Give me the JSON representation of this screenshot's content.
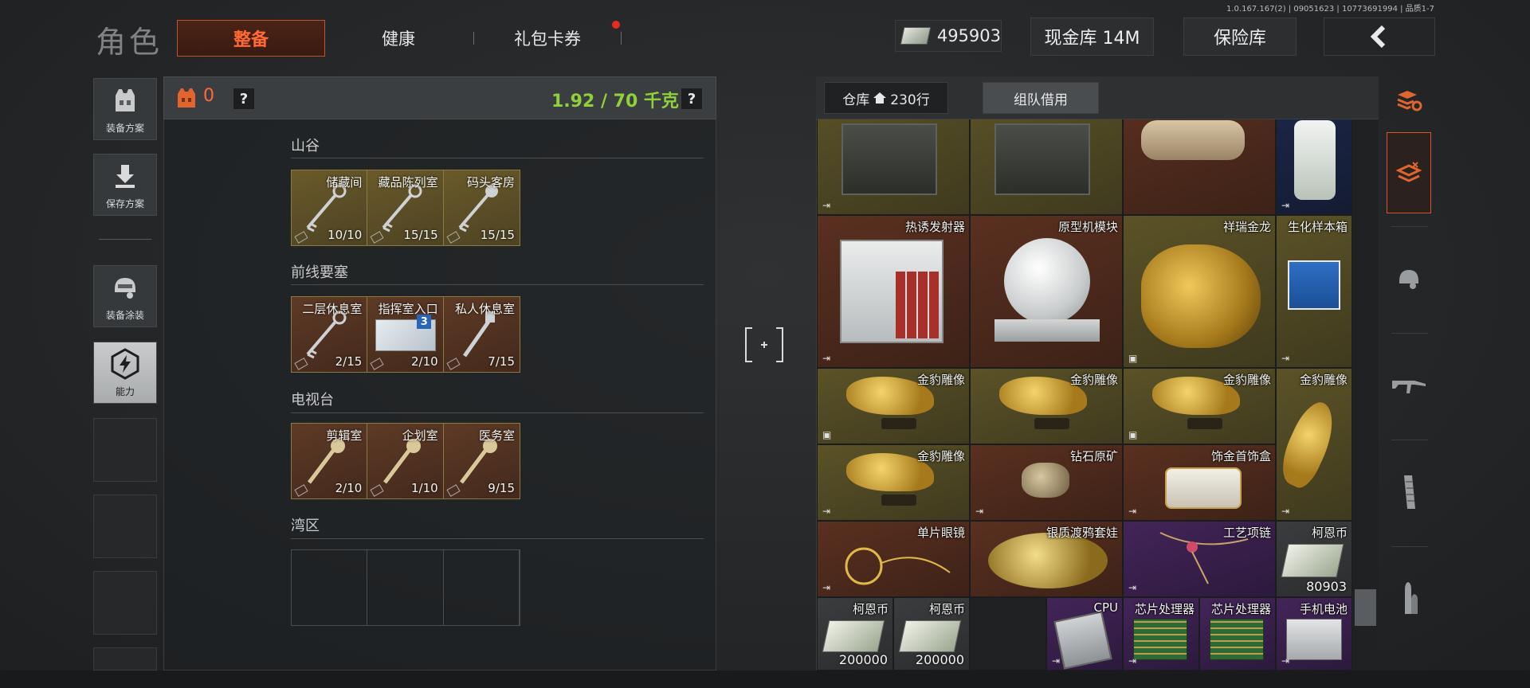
{
  "version": "1.0.167.167(2) | 09051623 | 10773691994 | 品质1-7",
  "header": {
    "title": "角色",
    "tabs": [
      {
        "label": "整备",
        "active": true
      },
      {
        "label": "健康",
        "active": false
      },
      {
        "label": "礼包卡券",
        "active": false,
        "notification": true
      }
    ],
    "currency": "495903",
    "cash_vault": "现金库 14M",
    "safe": "保险库"
  },
  "sidebar": {
    "items": [
      {
        "label": "装备方案",
        "icon": "vest-icon"
      },
      {
        "label": "保存方案",
        "icon": "download-icon"
      },
      {
        "label": "装备涂装",
        "icon": "helmet-icon"
      },
      {
        "label": "能力",
        "icon": "ability-icon",
        "active": true
      }
    ]
  },
  "inventory": {
    "count": "0",
    "help": "?",
    "weight": "1.92 / 70 千克",
    "sections": [
      {
        "title": "山谷",
        "keys": [
          {
            "name": "储藏间",
            "count": "10/10",
            "color": "olive"
          },
          {
            "name": "藏品陈列室",
            "count": "15/15",
            "color": "olive"
          },
          {
            "name": "码头客房",
            "count": "15/15",
            "color": "olive"
          }
        ]
      },
      {
        "title": "前线要塞",
        "keys": [
          {
            "name": "二层休息室",
            "count": "2/15",
            "color": "brown"
          },
          {
            "name": "指挥室入口",
            "count": "2/10",
            "color": "brown",
            "badge": "3"
          },
          {
            "name": "私人休息室",
            "count": "7/15",
            "color": "brown"
          }
        ]
      },
      {
        "title": "电视台",
        "keys": [
          {
            "name": "剪辑室",
            "count": "2/10",
            "color": "brown"
          },
          {
            "name": "企划室",
            "count": "1/10",
            "color": "brown"
          },
          {
            "name": "医务室",
            "count": "9/15",
            "color": "brown"
          }
        ]
      },
      {
        "title": "湾区",
        "keys": []
      }
    ]
  },
  "warehouse": {
    "tab_label": "仓库",
    "rows_label": "230行",
    "borrow_label": "组队借用",
    "items": [
      {
        "name": "热诱发射器",
        "color": "brown"
      },
      {
        "name": "原型机模块",
        "color": "brown"
      },
      {
        "name": "祥瑞金龙",
        "color": "olive"
      },
      {
        "name": "生化样本箱",
        "color": "olive"
      },
      {
        "name": "金豹雕像",
        "color": "olive"
      },
      {
        "name": "金豹雕像",
        "color": "olive"
      },
      {
        "name": "金豹雕像",
        "color": "olive"
      },
      {
        "name": "金豹雕像",
        "color": "olive"
      },
      {
        "name": "金豹雕像",
        "color": "olive"
      },
      {
        "name": "钻石原矿",
        "color": "brown"
      },
      {
        "name": "饰金首饰盒",
        "color": "brown"
      },
      {
        "name": "单片眼镜",
        "color": "brown"
      },
      {
        "name": "银质渡鸦套娃",
        "color": "brown"
      },
      {
        "name": "工艺项链",
        "color": "purple"
      },
      {
        "name": "柯恩币",
        "count": "80903",
        "color": "grey"
      },
      {
        "name": "柯恩币",
        "count": "200000",
        "color": "grey"
      },
      {
        "name": "柯恩币",
        "count": "200000",
        "color": "grey"
      },
      {
        "name": "CPU",
        "color": "purple"
      },
      {
        "name": "芯片处理器",
        "color": "purple"
      },
      {
        "name": "芯片处理器",
        "color": "purple"
      },
      {
        "name": "手机电池",
        "color": "purple"
      }
    ]
  }
}
